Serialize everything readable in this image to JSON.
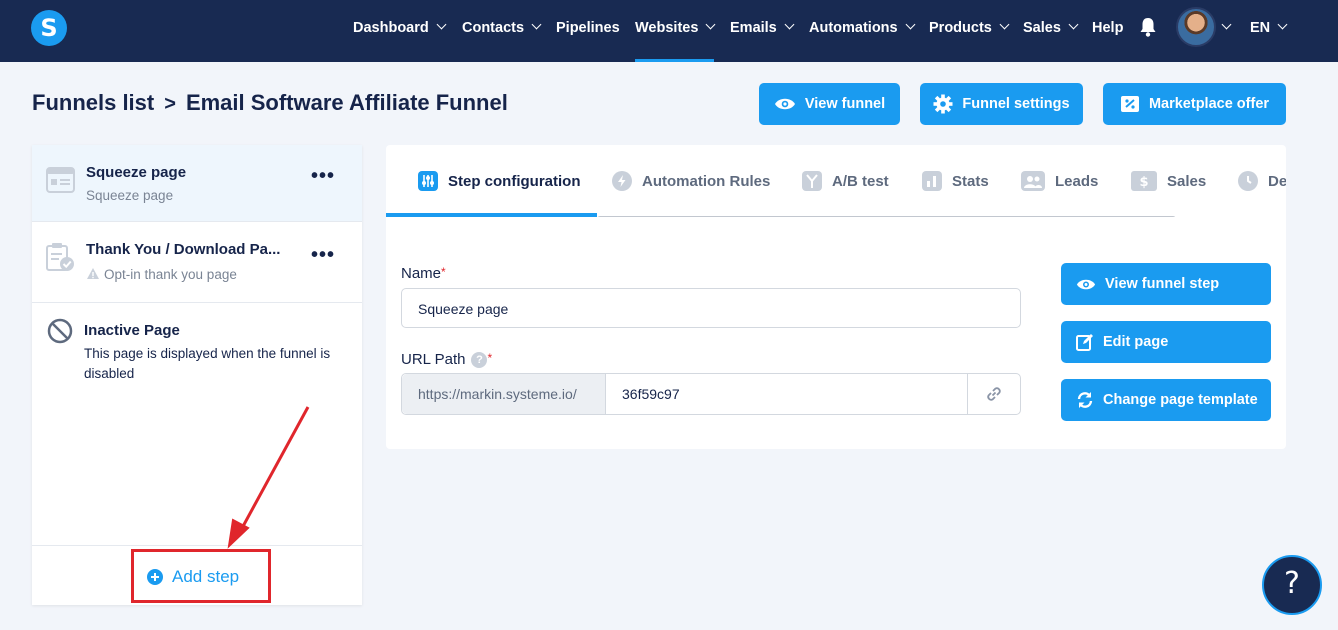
{
  "nav": {
    "logo": "S",
    "items": [
      {
        "label": "Dashboard",
        "chevron": true
      },
      {
        "label": "Contacts",
        "chevron": true
      },
      {
        "label": "Pipelines",
        "chevron": false
      },
      {
        "label": "Websites",
        "chevron": true,
        "active": true
      },
      {
        "label": "Emails",
        "chevron": true
      },
      {
        "label": "Automations",
        "chevron": true
      },
      {
        "label": "Products",
        "chevron": true
      },
      {
        "label": "Sales",
        "chevron": true
      },
      {
        "label": "Help",
        "chevron": false
      }
    ],
    "language": "EN",
    "accent_color": "#1a9bf0",
    "bg_color": "#182a52"
  },
  "breadcrumb": {
    "parent": "Funnels list",
    "separator": ">",
    "current": "Email Software Affiliate Funnel"
  },
  "header_buttons": {
    "view_funnel": "View funnel",
    "funnel_settings": "Funnel settings",
    "marketplace_offer": "Marketplace offer"
  },
  "steps": [
    {
      "title": "Squeeze page",
      "subtitle": "Squeeze page",
      "selected": true,
      "icon": "squeeze-page-icon"
    },
    {
      "title": "Thank You / Download Pa...",
      "subtitle": "Opt-in thank you page",
      "selected": false,
      "icon": "clipboard-check-icon",
      "warning": true
    }
  ],
  "inactive_page": {
    "title": "Inactive Page",
    "description": "This page is displayed when the funnel is disabled"
  },
  "add_step_label": "Add step",
  "tabs": [
    {
      "label": "Step configuration",
      "icon": "sliders-icon",
      "active": true
    },
    {
      "label": "Automation Rules",
      "icon": "bolt-icon"
    },
    {
      "label": "A/B test",
      "icon": "split-icon"
    },
    {
      "label": "Stats",
      "icon": "bar-chart-icon"
    },
    {
      "label": "Leads",
      "icon": "users-icon"
    },
    {
      "label": "Sales",
      "icon": "dollar-icon"
    },
    {
      "label": "De",
      "icon": "clock-icon"
    }
  ],
  "form": {
    "name_label": "Name",
    "name_required": "*",
    "name_value": "Squeeze page",
    "url_label": "URL Path",
    "url_required": "*",
    "url_help": "?",
    "url_prefix": "https://markin.systeme.io/",
    "url_value": "36f59c97"
  },
  "side_buttons": {
    "view_step": "View funnel step",
    "edit_page": "Edit page",
    "change_template": "Change page template"
  },
  "help_bubble": "?"
}
